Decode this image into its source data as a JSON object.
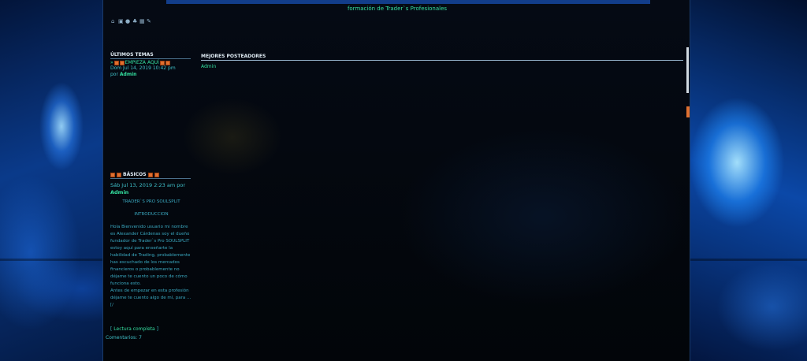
{
  "header": {
    "slogan": "formación de Trader`s Profesionales"
  },
  "toolbar": {
    "icons": [
      "home-icon",
      "image-icon",
      "user-icon",
      "users-icon",
      "calendar-icon",
      "edit-icon"
    ]
  },
  "left": {
    "latest_topics": {
      "title": "ÚLTIMOS TEMAS",
      "topic_prefix": "»",
      "topic_label": "EMPIEZA AQUÍ",
      "date": "Dom Jul 14, 2019 10:42 pm",
      "by": "por",
      "author": "Admin"
    },
    "basicos": {
      "title": "BÁSICOS",
      "date": "Sáb Jul 13, 2019 2:23 am por",
      "author": "Admin",
      "heading1": "TRADER`S PRO SOULSPLIT",
      "heading2": "INTRODUCCION",
      "body": "Hola Bienvenido usuario mi nombre es Alexander Cárdenas soy el dueño fundador de Trader`s Pro SOULSPLIT estoy aquí para enseñarte la habilidad de Trading, probablemente has escuchado de los mercados financieros o probablemente no déjame te cuento un poco de cómo funciona esto.",
      "body2": "Antes de empezar en esta profesión déjame te cuento algo de mí, para ...[/",
      "read_more_open": "[",
      "read_more": "Lectura completa",
      "read_more_close": "]",
      "comments_label": "Comentarios:",
      "comments_count": "7"
    }
  },
  "right": {
    "title": "MEJORES POSTEADORES",
    "posters": [
      "Admin"
    ]
  }
}
